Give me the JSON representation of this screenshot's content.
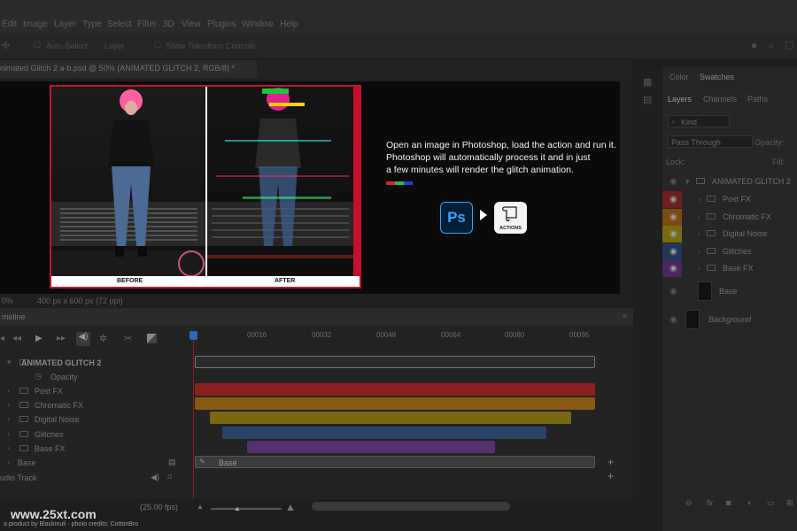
{
  "menu": [
    "Edit",
    "Image",
    "Layer",
    "Type",
    "Select",
    "Filter",
    "3D",
    "View",
    "Plugins",
    "Window",
    "Help"
  ],
  "options": {
    "auto_select": "Auto-Select:",
    "layer_select": "Layer",
    "transform_controls": "Show Transform Controls"
  },
  "document_tab": "nimated Glitch 2 a-b.psd @ 50% (ANIMATED GLITCH 2, RGB/8) *",
  "artboard": {
    "before_label": "BEFORE",
    "after_label": "AFTER",
    "info_lines": [
      "Open an image in Photoshop, load the action and run it.",
      "Photoshop will automatically process it and in just",
      "a few minutes will render the glitch animation."
    ],
    "ps_label": "Ps",
    "actions_label": "ACTIONS"
  },
  "status": {
    "zoom": "0%",
    "size": "400 px x 600 px (72 ppi)"
  },
  "timeline": {
    "title": "meline",
    "ruler_ticks": [
      "00016",
      "00032",
      "00048",
      "00064",
      "00080",
      "00096"
    ],
    "group_name": "ANIMATED GLITCH 2",
    "opacity_label": "Opacity",
    "tracks": [
      "Post FX",
      "Chromatic FX",
      "Digital Noise",
      "Glitches",
      "Base FX"
    ],
    "base_label": "Base",
    "audio_label": "udio Track",
    "fps": "(25.00 fps)"
  },
  "right_panel": {
    "tabs_top": [
      "Color",
      "Swatches"
    ],
    "tabs_layers": [
      "Layers",
      "Channels",
      "Paths"
    ],
    "kind": "Kind",
    "blend_mode": "Pass Through",
    "opacity": "Opacity:",
    "lock": "Lock:",
    "fill": "Fill:",
    "group": "ANIMATED GLITCH 2",
    "layers": [
      {
        "name": "Post FX",
        "color": "#6e1f1f"
      },
      {
        "name": "Chromatic FX",
        "color": "#7a4a10"
      },
      {
        "name": "Digital Noise",
        "color": "#7a6a10"
      },
      {
        "name": "Glitches",
        "color": "#23365a"
      },
      {
        "name": "Base FX",
        "color": "#4a2660"
      }
    ],
    "base_layer": "Base",
    "background_layer": "Background"
  },
  "footer": {
    "watermark": "www.25xt.com",
    "credit": "a product by Blackmuli - photo credits: CottonBro"
  },
  "colors": {
    "post_fx": "#8b2020",
    "chromatic_fx": "#8a5a12",
    "digital_noise": "#7a6810",
    "glitches": "#2a4468",
    "base_fx": "#55306e",
    "ps_blue": "#31a8ff",
    "frame_red": "#c8102e"
  }
}
